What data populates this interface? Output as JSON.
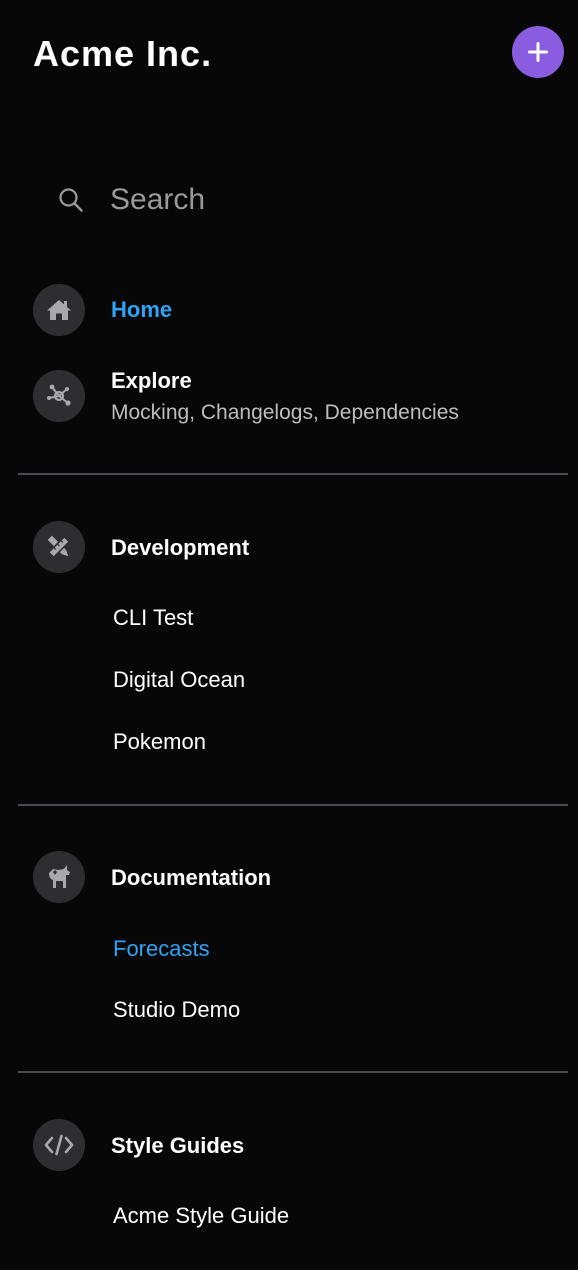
{
  "brand": {
    "name": "Acme Inc."
  },
  "header": {
    "add_icon": "plus-icon"
  },
  "search": {
    "placeholder": "Search",
    "icon": "search-icon"
  },
  "nav": {
    "home": {
      "label": "Home",
      "icon": "home-icon",
      "active": true
    },
    "explore": {
      "label": "Explore",
      "subtitle": "Mocking, Changelogs, Dependencies",
      "icon": "nodes-icon"
    }
  },
  "sections": [
    {
      "title": "Development",
      "icon": "pencil-ruler-icon",
      "items": [
        {
          "label": "CLI Test"
        },
        {
          "label": "Digital Ocean"
        },
        {
          "label": "Pokemon"
        }
      ]
    },
    {
      "title": "Documentation",
      "icon": "unicorn-icon",
      "items": [
        {
          "label": "Forecasts",
          "active": true
        },
        {
          "label": "Studio Demo"
        }
      ]
    },
    {
      "title": "Style Guides",
      "icon": "code-icon",
      "items": [
        {
          "label": "Acme Style Guide"
        }
      ]
    }
  ],
  "colors": {
    "background": "#070707",
    "accent": "#2fa3f5",
    "add_button": "#8a5ce0",
    "icon_circle": "#2e2e30",
    "divider": "#4a4a50"
  }
}
